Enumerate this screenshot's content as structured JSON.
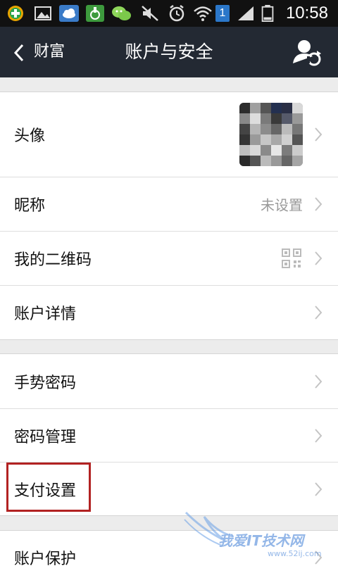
{
  "status_bar": {
    "time": "10:58",
    "battery_badge": "1",
    "icons": [
      "add-icon",
      "gallery-icon",
      "cloud-icon",
      "lock-icon",
      "wechat-icon",
      "mute-icon",
      "alarm-icon",
      "wifi-icon",
      "sim-badge-icon",
      "signal-icon",
      "battery-icon"
    ]
  },
  "header": {
    "back_label": "财富",
    "title": "账户与安全"
  },
  "groups": [
    {
      "rows": [
        {
          "label": "头像",
          "type": "avatar"
        },
        {
          "label": "昵称",
          "value": "未设置"
        },
        {
          "label": "我的二维码",
          "type": "qr"
        },
        {
          "label": "账户详情"
        }
      ]
    },
    {
      "rows": [
        {
          "label": "手势密码"
        },
        {
          "label": "密码管理"
        },
        {
          "label": "支付设置",
          "highlighted": true
        }
      ]
    },
    {
      "rows": [
        {
          "label": "账户保护"
        }
      ]
    }
  ],
  "watermark": {
    "text": "我爱IT技术网",
    "url": "www.52ij.com"
  },
  "colors": {
    "title_bar": "#232933",
    "status_bar": "#111111",
    "background": "#ececec",
    "highlight": "#b22222",
    "value_text": "#9a9a9a"
  }
}
